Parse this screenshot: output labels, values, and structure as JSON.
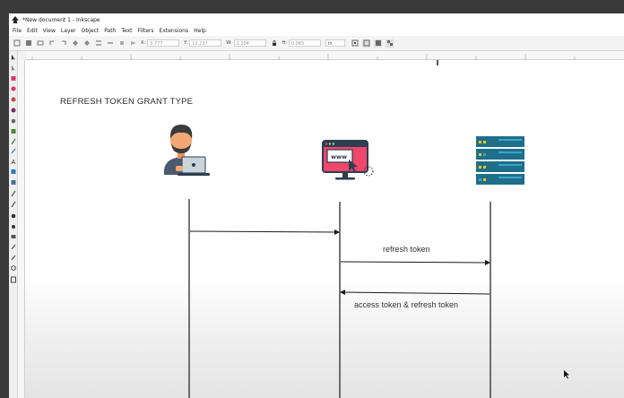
{
  "window": {
    "title": "*New document 1 - Inkscape"
  },
  "menu": [
    "File",
    "Edit",
    "View",
    "Layer",
    "Object",
    "Path",
    "Text",
    "Filters",
    "Extensions",
    "Help"
  ],
  "toolbar": {
    "x_label": "X:",
    "x_value": "3.777",
    "y_label": "Y:",
    "y_value": "12.237",
    "w_label": "W:",
    "w_value": "1.204",
    "h_label": "H:",
    "h_value": "0.065",
    "unit": "in"
  },
  "diagram": {
    "title": "REFRESH TOKEN GRANT TYPE",
    "icons": [
      "user-with-laptop-icon",
      "web-browser-icon",
      "server-rack-icon"
    ],
    "messages": [
      {
        "label": "",
        "direction": "right"
      },
      {
        "label": "refresh token",
        "direction": "right"
      },
      {
        "label": "access token & refresh token",
        "direction": "left"
      }
    ],
    "colors": {
      "skin": "#f2a774",
      "hair": "#3b3b3b",
      "shirt": "#4a5b6e",
      "browser_pink": "#f0476a",
      "browser_frame": "#2c3e50",
      "server_teal": "#1f6f8b",
      "server_light": "#3aa6c8",
      "led_yellow": "#f5c518",
      "line": "#1a1a1a"
    }
  }
}
